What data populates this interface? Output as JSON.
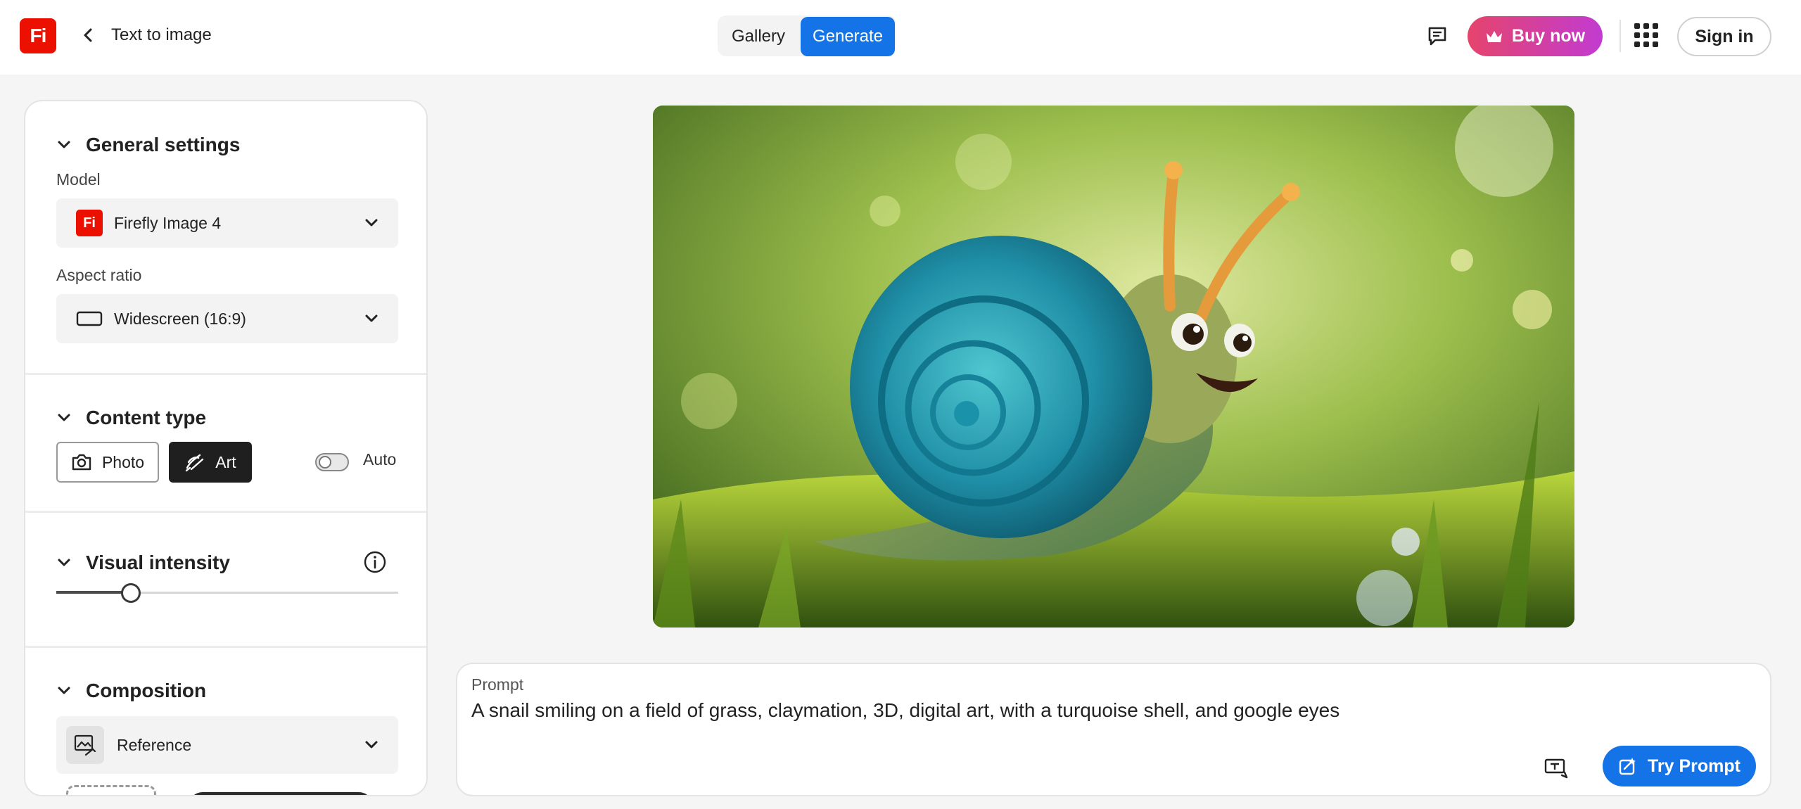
{
  "app": {
    "logo_text": "Fi",
    "page_title": "Text to image"
  },
  "nav": {
    "tabs": [
      {
        "label": "Gallery",
        "active": false
      },
      {
        "label": "Generate",
        "active": true
      }
    ],
    "buy_label": "Buy now",
    "signin_label": "Sign in"
  },
  "settings": {
    "general": {
      "heading": "General settings",
      "model_label": "Model",
      "model_value": "Firefly Image 4",
      "model_icon_text": "Fi",
      "aspect_label": "Aspect ratio",
      "aspect_value": "Widescreen (16:9)"
    },
    "content_type": {
      "heading": "Content type",
      "options": [
        {
          "label": "Photo",
          "selected": false
        },
        {
          "label": "Art",
          "selected": true
        }
      ],
      "auto_label": "Auto",
      "auto_enabled": false
    },
    "visual_intensity": {
      "heading": "Visual intensity",
      "level": 0.2
    },
    "composition": {
      "heading": "Composition",
      "reference_label": "Reference"
    }
  },
  "prompt": {
    "label": "Prompt",
    "text": "A snail smiling on a field of grass, claymation, 3D, digital art, with a turquoise shell, and google eyes",
    "try_label": "Try Prompt"
  },
  "colors": {
    "accent": "#1473e6",
    "brand": "#eb1000",
    "buy_gradient_start": "#e5446c",
    "buy_gradient_end": "#c23bd1"
  }
}
